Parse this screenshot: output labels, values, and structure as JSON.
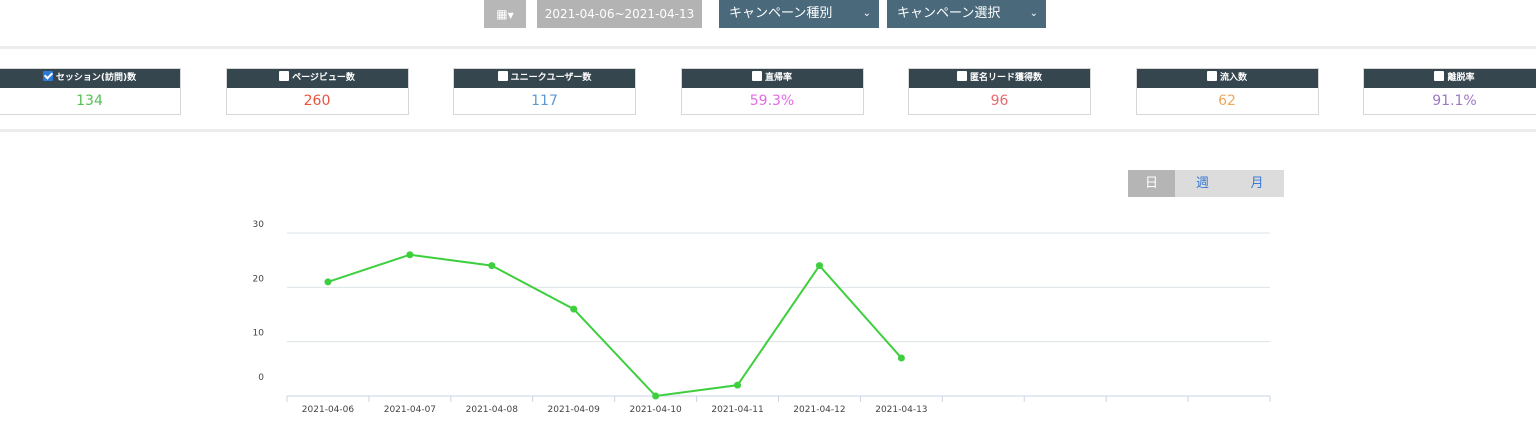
{
  "toolbar": {
    "calendar_icon": "calendar-icon",
    "date_range": "2021-04-06~2021-04-13",
    "campaign_type": "キャンペーン種別",
    "campaign_select": "キャンペーン選択"
  },
  "kpis": [
    {
      "label": "セッション(訪問)数",
      "value": "134",
      "checked": true,
      "color": "#52c353"
    },
    {
      "label": "ページビュー数",
      "value": "260",
      "checked": false,
      "color": "#e8533c"
    },
    {
      "label": "ユニークユーザー数",
      "value": "117",
      "checked": false,
      "color": "#5b9bd5"
    },
    {
      "label": "直帰率",
      "value": "59.3%",
      "checked": false,
      "color": "#e36be6"
    },
    {
      "label": "匿名リード獲得数",
      "value": "96",
      "checked": false,
      "color": "#e8696f"
    },
    {
      "label": "流入数",
      "value": "62",
      "checked": false,
      "color": "#f2a65a"
    },
    {
      "label": "離脱率",
      "value": "91.1%",
      "checked": false,
      "color": "#9e78c2"
    }
  ],
  "period_buttons": {
    "day": "日",
    "week": "週",
    "month": "月"
  },
  "chart_data": {
    "type": "line",
    "categories": [
      "2021-04-06",
      "2021-04-07",
      "2021-04-08",
      "2021-04-09",
      "2021-04-10",
      "2021-04-11",
      "2021-04-12",
      "2021-04-13",
      "",
      "",
      "",
      ""
    ],
    "series": [
      {
        "values": [
          21,
          26,
          24,
          16,
          0,
          2,
          24,
          7
        ],
        "color": "#3ecf3e"
      }
    ],
    "ylim": [
      0,
      30
    ],
    "yticks": [
      0,
      10,
      20,
      30
    ],
    "grid": true
  }
}
